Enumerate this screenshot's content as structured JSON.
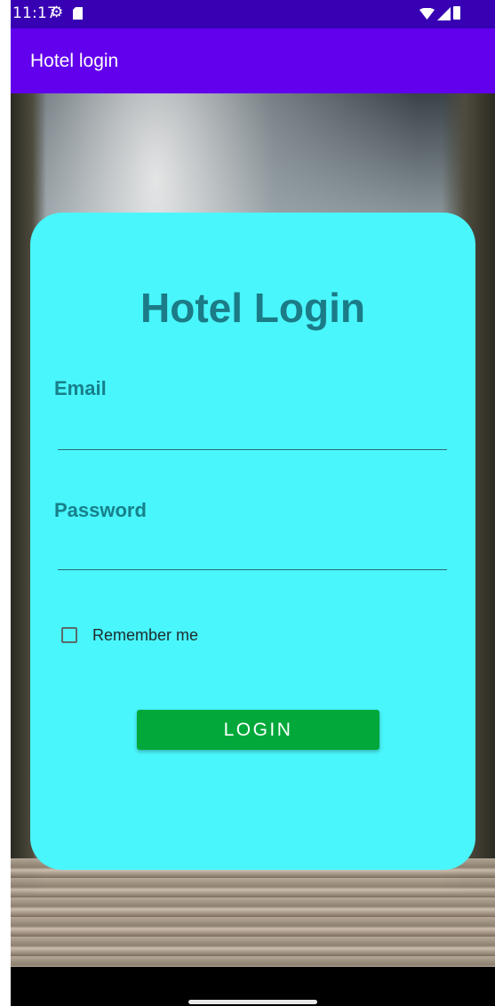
{
  "status_bar": {
    "time": "11:17",
    "icons": [
      "gear-icon",
      "sd-card-icon",
      "wifi-icon",
      "signal-icon",
      "battery-icon"
    ],
    "background_color": "#3700b3"
  },
  "app_bar": {
    "title": "Hotel login",
    "background_color": "#6200ee"
  },
  "login_card": {
    "title": "Hotel Login",
    "background_color": "#49f6fb",
    "email": {
      "label": "Email",
      "value": ""
    },
    "password": {
      "label": "Password",
      "value": ""
    },
    "remember_me": {
      "label": "Remember me",
      "checked": false
    },
    "login_button": {
      "label": "LOGIN",
      "color": "#02a93a"
    }
  }
}
